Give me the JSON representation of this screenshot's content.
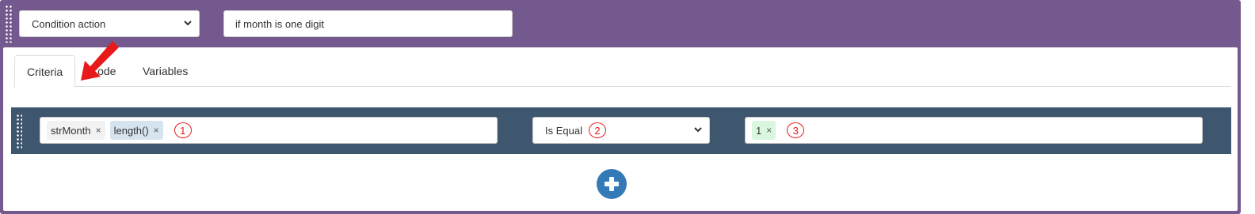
{
  "header": {
    "action_select_value": "Condition action",
    "description_value": "if month is one digit"
  },
  "tabs": [
    {
      "label": "Criteria",
      "active": true
    },
    {
      "label": "Code",
      "active": false
    },
    {
      "label": "Variables",
      "active": false
    }
  ],
  "criteria": {
    "left_tags": [
      {
        "label": "strMonth",
        "remove": "×"
      },
      {
        "label": "length()",
        "remove": "×"
      }
    ],
    "left_marker": "1",
    "operator_value": "Is Equal",
    "operator_marker": "2",
    "right_tags": [
      {
        "label": "1",
        "remove": "×"
      }
    ],
    "right_marker": "3"
  },
  "colors": {
    "frame": "#74598f",
    "criteria_row": "#3f566f",
    "add_button": "#337ab7",
    "annotation": "#e81919"
  },
  "icons": {
    "add": "plus-circle-icon",
    "select": "chevron-down-icon",
    "annotation": "red-arrow-icon"
  }
}
